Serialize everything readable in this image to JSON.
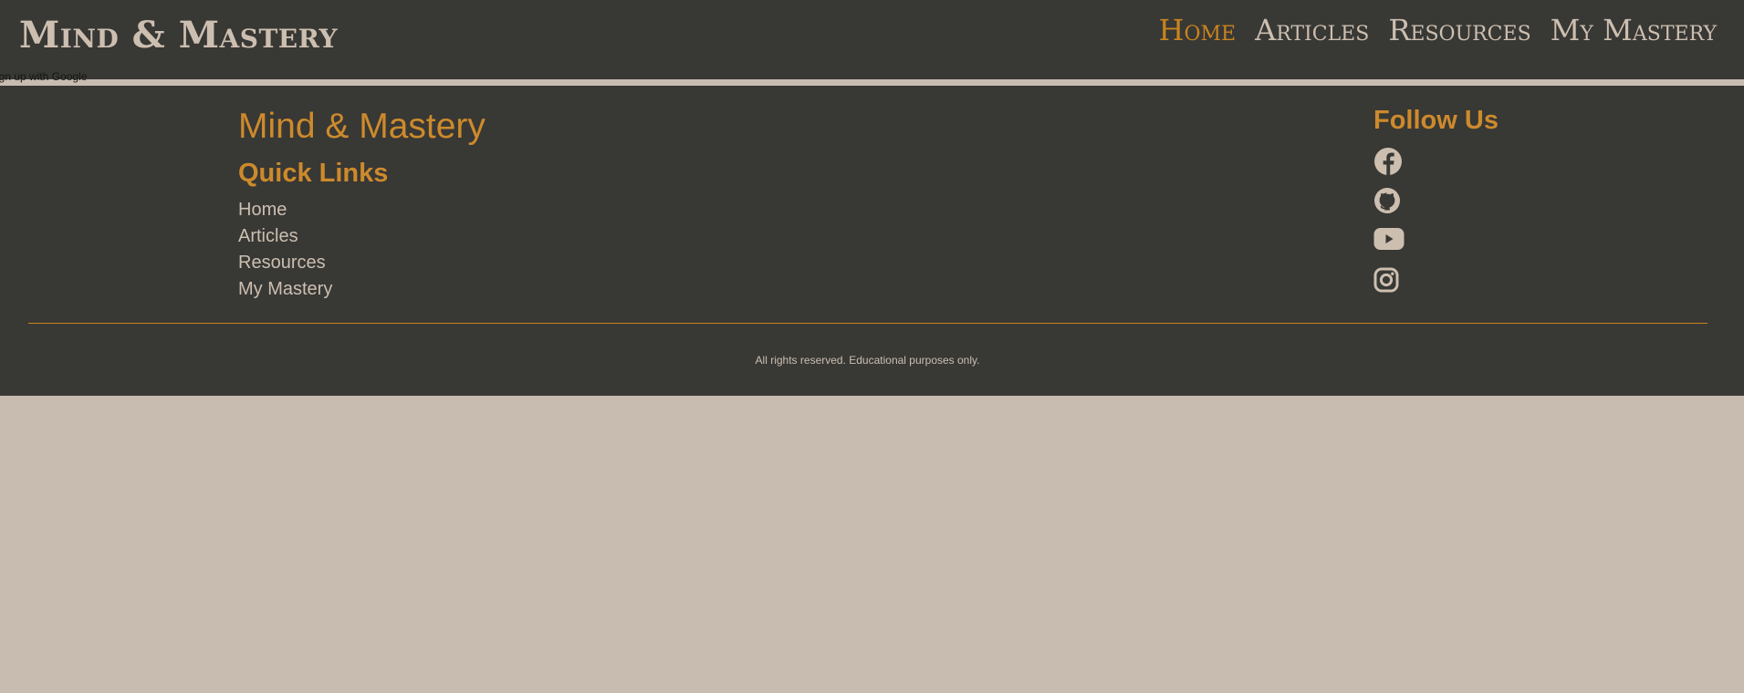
{
  "header": {
    "brand": "Mind & Mastery",
    "nav": [
      {
        "label": "Home",
        "active": true
      },
      {
        "label": "Articles",
        "active": false
      },
      {
        "label": "Resources",
        "active": false
      },
      {
        "label": "My Mastery",
        "active": false
      }
    ]
  },
  "signup_text": "Sign up with Google",
  "footer": {
    "title": "Mind & Mastery",
    "quick_links_heading": "Quick Links",
    "quick_links": [
      "Home",
      "Articles",
      "Resources",
      "My Mastery"
    ],
    "follow_heading": "Follow Us",
    "social_icons": [
      "facebook-icon",
      "github-icon",
      "youtube-icon",
      "instagram-icon"
    ],
    "copyright": "All rights reserved. Educational purposes only."
  },
  "colors": {
    "dark_background": "#383835",
    "page_background": "#c8bcb0",
    "accent": "#c9841f",
    "light_text": "#cdbfb0"
  }
}
